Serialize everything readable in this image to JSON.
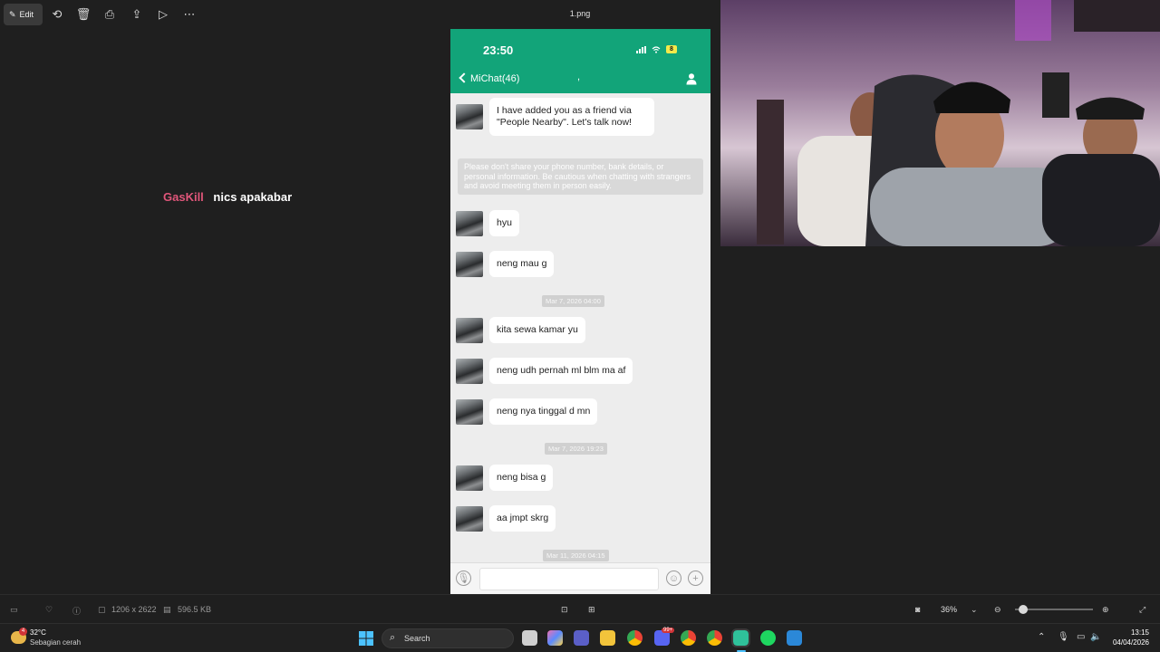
{
  "toolbar": {
    "edit_label": "Edit",
    "file_name": "1.png"
  },
  "overlay_chat": {
    "user": "GasKill",
    "message": "nics apakabar"
  },
  "phone": {
    "time": "23:50",
    "battery": "8",
    "chat_title": "MiChat(46)",
    "chat_subtitle": ",",
    "first_message": "I have added you as a friend via \"People Nearby\". Let's talk now!",
    "notice": "Please don't share your phone number, bank details, or personal information. Be cautious when chatting with strangers and avoid meeting them in person easily.",
    "messages": [
      "hyu",
      "neng mau g",
      "kita sewa kamar yu",
      "neng udh pernah ml blm ma af",
      "neng nya tinggal d mn",
      "neng bisa g",
      "aa jmpt skrg"
    ],
    "dates": [
      "Mar 7, 2026 04:00",
      "Mar 7, 2026 19:23",
      "Mar 11, 2026 04:15"
    ]
  },
  "status_bar": {
    "dimensions": "1206 x 2622",
    "file_size": "596.5 KB",
    "zoom": "36%",
    "zoom_fraction": 0.05
  },
  "taskbar": {
    "weather_temp": "32°C",
    "weather_desc": "Sebagian cerah",
    "weather_badge": "4",
    "search_placeholder": "Search",
    "time": "13:15",
    "date": "04/04/2026",
    "discord_badge": "99+"
  }
}
